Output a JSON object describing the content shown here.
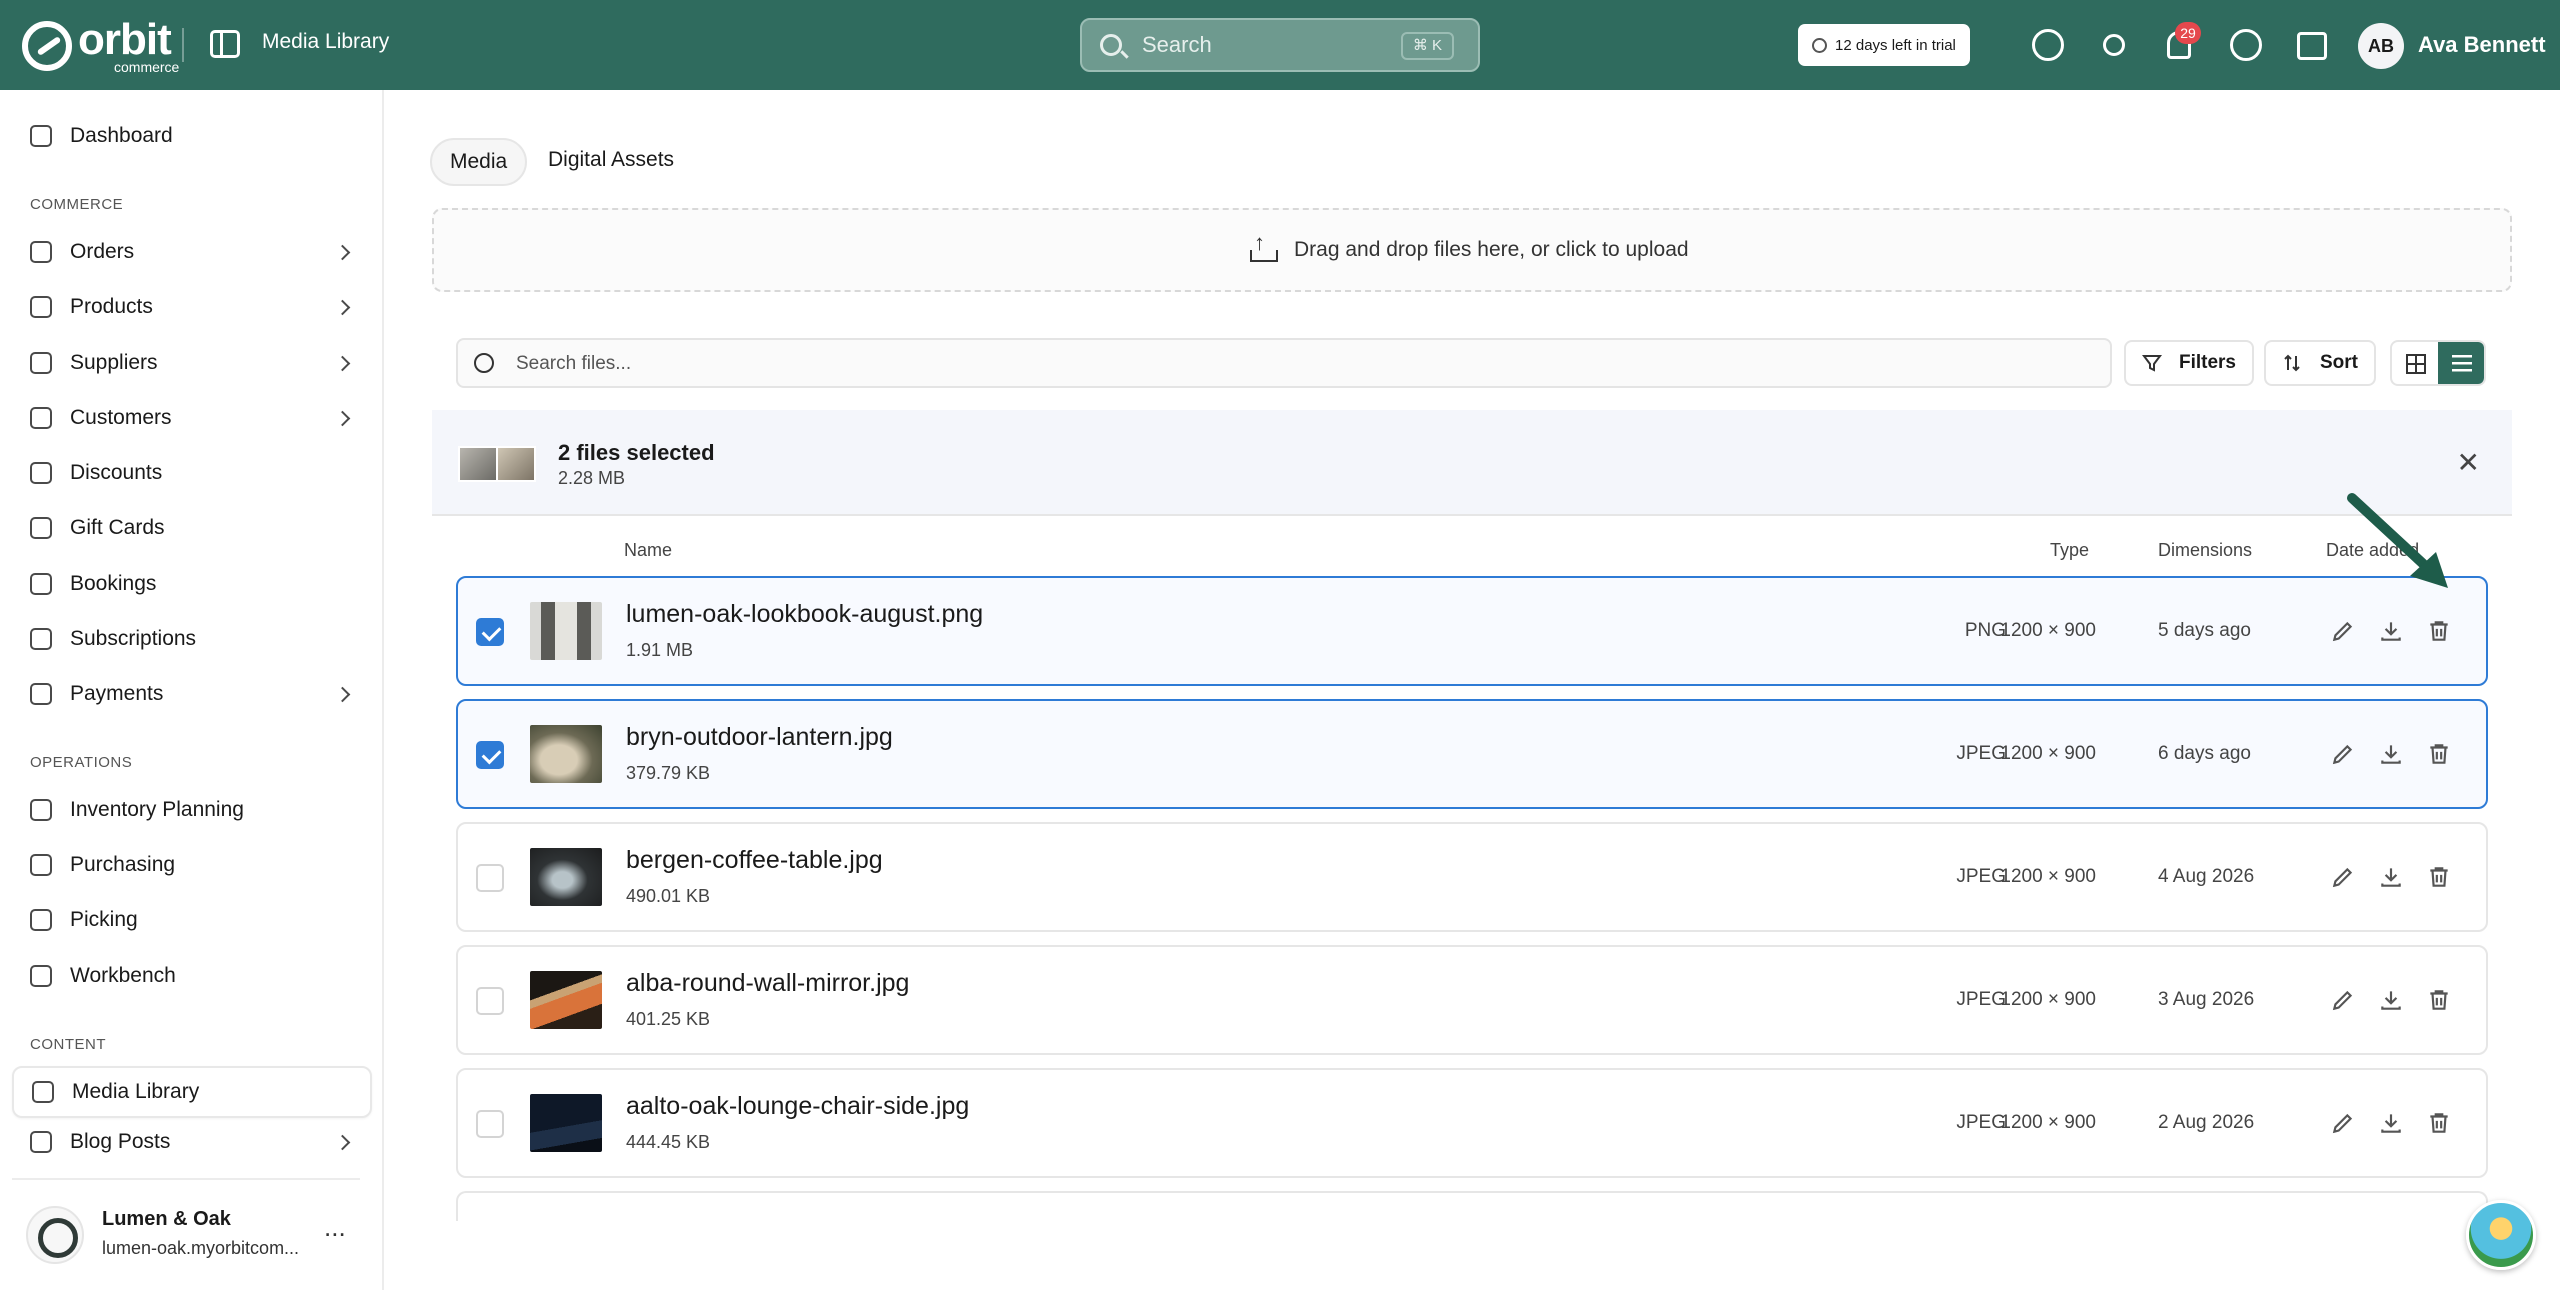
{
  "header": {
    "brand": "orbit",
    "brand_sub": "commerce",
    "app_title": "Media Library",
    "search_placeholder": "Search",
    "search_shortcut": "⌘ K",
    "trial_text": "12 days left in trial",
    "notifications_count": "29",
    "user_initials": "AB",
    "user_name": "Ava Bennett",
    "icons": [
      "sidebar-toggle-icon",
      "ai-assistant-icon",
      "sun-icon",
      "bell-icon",
      "help-icon",
      "store-icon"
    ]
  },
  "sidebar": {
    "dashboard": "Dashboard",
    "section_commerce": "COMMERCE",
    "orders": "Orders",
    "products": "Products",
    "suppliers": "Suppliers",
    "customers": "Customers",
    "discounts": "Discounts",
    "gift_cards": "Gift Cards",
    "bookings": "Bookings",
    "subscriptions": "Subscriptions",
    "payments": "Payments",
    "section_operations": "OPERATIONS",
    "inventory_planning": "Inventory Planning",
    "purchasing": "Purchasing",
    "picking": "Picking",
    "workbench": "Workbench",
    "section_content": "CONTENT",
    "media_library": "Media Library",
    "blog_posts": "Blog Posts",
    "store_name": "Lumen & Oak",
    "store_domain": "lumen-oak.myorbitcom...",
    "more": "..."
  },
  "main": {
    "tabs": {
      "media": "Media",
      "digital_assets": "Digital Assets"
    },
    "dropzone_label": "Drag and drop files here, or click to upload",
    "file_search_placeholder": "Search files...",
    "filters_label": "Filters",
    "sort_label": "Sort",
    "selection": {
      "count_label": "2 files selected",
      "size": "2.28 MB"
    },
    "columns": {
      "name": "Name",
      "type": "Type",
      "dimensions": "Dimensions",
      "date_added": "Date added"
    },
    "files": [
      {
        "name": "lumen-oak-lookbook-august.png",
        "size": "1.91 MB",
        "type": "PNG",
        "dimensions": "1200 × 900",
        "date": "5 days ago",
        "selected": true
      },
      {
        "name": "bryn-outdoor-lantern.jpg",
        "size": "379.79 KB",
        "type": "JPEG",
        "dimensions": "1200 × 900",
        "date": "6 days ago",
        "selected": true
      },
      {
        "name": "bergen-coffee-table.jpg",
        "size": "490.01 KB",
        "type": "JPEG",
        "dimensions": "1200 × 900",
        "date": "4 Aug 2026",
        "selected": false
      },
      {
        "name": "alba-round-wall-mirror.jpg",
        "size": "401.25 KB",
        "type": "JPEG",
        "dimensions": "1200 × 900",
        "date": "3 Aug 2026",
        "selected": false
      },
      {
        "name": "aalto-oak-lounge-chair-side.jpg",
        "size": "444.45 KB",
        "type": "JPEG",
        "dimensions": "1200 × 900",
        "date": "2 Aug 2026",
        "selected": false
      }
    ]
  },
  "colors": {
    "brand": "#2f6b5e",
    "selection": "#2e7bd6",
    "badge": "#e5484d"
  }
}
